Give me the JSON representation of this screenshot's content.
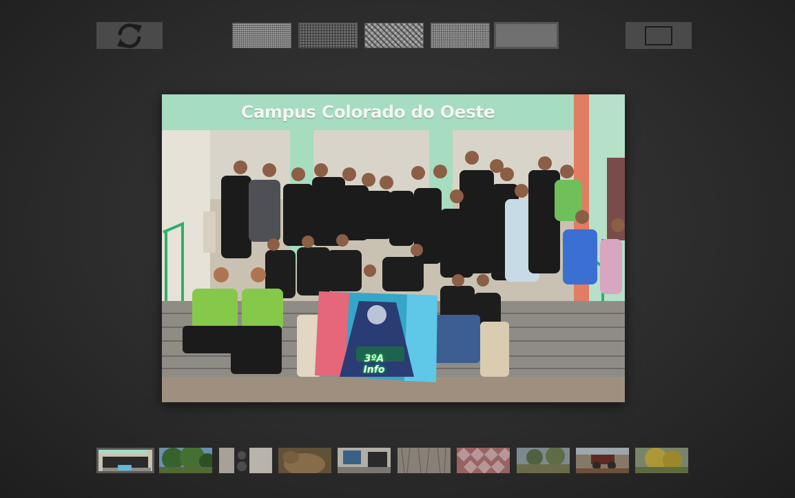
{
  "toolbar": {
    "refresh_icon": "refresh-icon",
    "fullscreen_icon": "fullscreen-icon",
    "backgrounds": [
      {
        "name": "fine-grid-pattern"
      },
      {
        "name": "square-grid-pattern"
      },
      {
        "name": "weave-pattern"
      },
      {
        "name": "noise-pattern"
      },
      {
        "name": "solid-gray",
        "selected": true
      }
    ]
  },
  "viewer": {
    "photo": {
      "sign_text": "Campus Colorado do Oeste",
      "banner_text": "3ºA Info"
    }
  },
  "thumbnails": {
    "active_index": 0,
    "items": [
      {
        "name": "group-photo-thumb"
      },
      {
        "name": "tree-thumb"
      },
      {
        "name": "speaker-thumb"
      },
      {
        "name": "animal-thumb"
      },
      {
        "name": "workshop-thumb"
      },
      {
        "name": "wall-texture-thumb"
      },
      {
        "name": "mosaic-floor-thumb"
      },
      {
        "name": "field-thumb"
      },
      {
        "name": "tractor-thumb"
      },
      {
        "name": "yellow-tree-thumb"
      }
    ]
  }
}
